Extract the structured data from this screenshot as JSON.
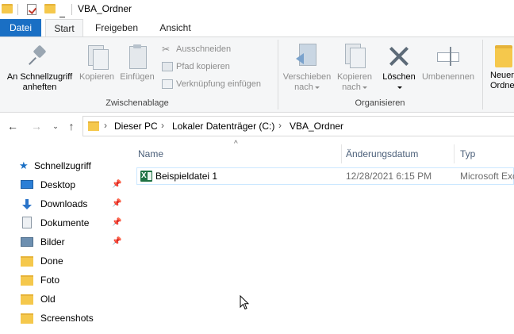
{
  "window": {
    "title": "VBA_Ordner"
  },
  "ribbon_tabs": {
    "file": "Datei",
    "start": "Start",
    "share": "Freigeben",
    "view": "Ansicht"
  },
  "ribbon": {
    "clipboard": {
      "pin_label_1": "An Schnellzugriff",
      "pin_label_2": "anheften",
      "copy": "Kopieren",
      "paste": "Einfügen",
      "cut": "Ausschneiden",
      "copy_path": "Pfad kopieren",
      "paste_shortcut": "Verknüpfung einfügen",
      "group_label": "Zwischenablage"
    },
    "organize": {
      "move_to_1": "Verschieben",
      "move_to_2": "nach",
      "copy_to_1": "Kopieren",
      "copy_to_2": "nach",
      "delete": "Löschen",
      "rename": "Umbenennen",
      "group_label": "Organisieren"
    },
    "new": {
      "new_folder_1": "Neuer",
      "new_folder_2": "Ordne"
    }
  },
  "address": {
    "crumbs": [
      "Dieser PC",
      "Lokaler Datenträger (C:)",
      "VBA_Ordner"
    ]
  },
  "navpane": {
    "quick_access": "Schnellzugriff",
    "items": [
      {
        "label": "Desktop",
        "icon": "desktop-icon",
        "pinned": true
      },
      {
        "label": "Downloads",
        "icon": "download-icon",
        "pinned": true
      },
      {
        "label": "Dokumente",
        "icon": "document-icon",
        "pinned": true
      },
      {
        "label": "Bilder",
        "icon": "pictures-icon",
        "pinned": true
      },
      {
        "label": "Done",
        "icon": "folder-icon",
        "pinned": false
      },
      {
        "label": "Foto",
        "icon": "folder-icon",
        "pinned": false
      },
      {
        "label": "Old",
        "icon": "folder-icon",
        "pinned": false
      },
      {
        "label": "Screenshots",
        "icon": "folder-icon",
        "pinned": false
      }
    ]
  },
  "filelist": {
    "columns": {
      "name": "Name",
      "date": "Änderungsdatum",
      "type": "Typ"
    },
    "rows": [
      {
        "name": "Beispieldatei 1",
        "date": "12/28/2021 6:15 PM",
        "type": "Microsoft Exc",
        "icon": "excel-file-icon"
      }
    ]
  },
  "colors": {
    "file_tab": "#1a6fc4",
    "folder": "#f5c84c",
    "selection_border": "#cce8ff",
    "excel": "#1f7244"
  }
}
